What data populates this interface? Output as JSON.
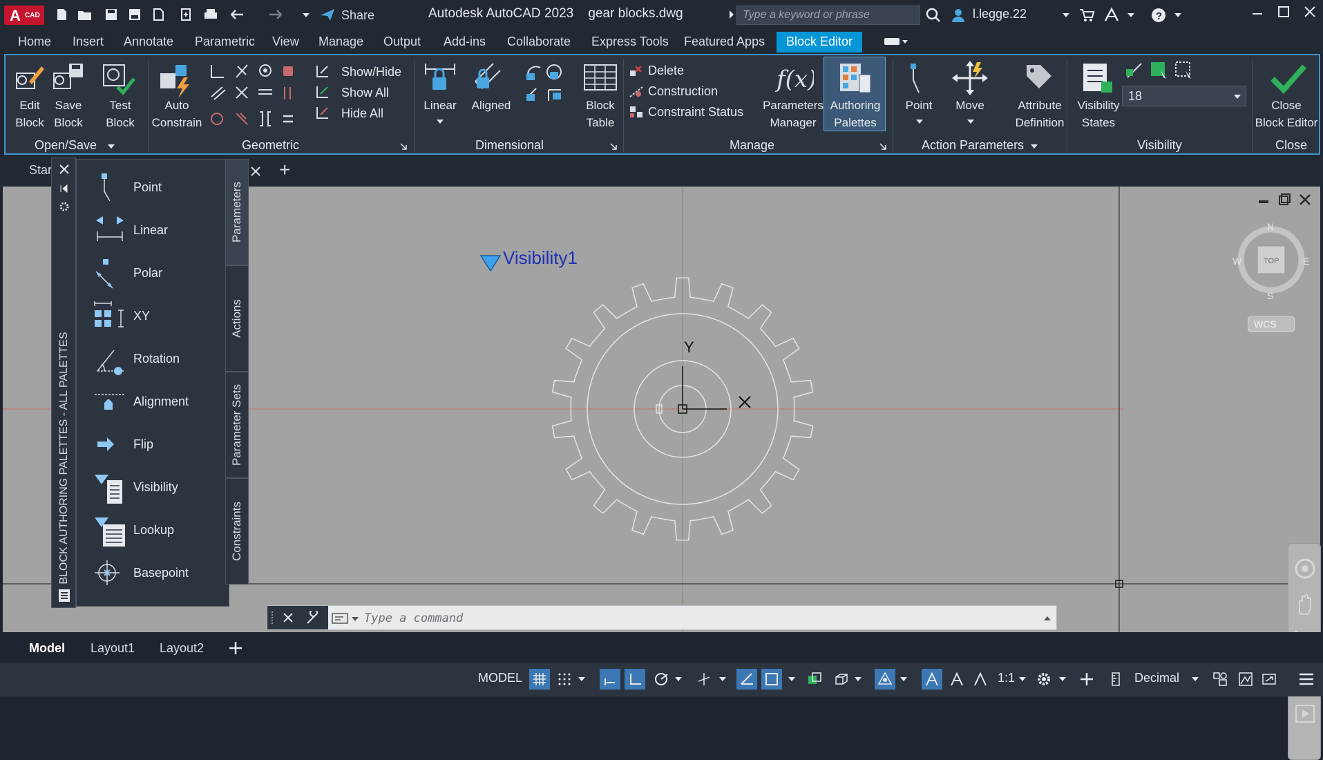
{
  "titlebar": {
    "app_badge_letter": "A",
    "app_badge_text": "CAD",
    "share_label": "Share",
    "app_title": "Autodesk AutoCAD 2023",
    "file_name": "gear blocks.dwg",
    "search_placeholder": "Type a keyword or phrase",
    "user_name": "l.legge.22"
  },
  "ribbon_tabs": [
    "Home",
    "Insert",
    "Annotate",
    "Parametric",
    "View",
    "Manage",
    "Output",
    "Add-ins",
    "Collaborate",
    "Express Tools",
    "Featured Apps",
    "Block Editor"
  ],
  "ribbon": {
    "open_save": {
      "title": "Open/Save",
      "edit_block": [
        "Edit",
        "Block"
      ],
      "save_block": [
        "Save",
        "Block"
      ],
      "test_block": [
        "Test",
        "Block"
      ]
    },
    "geometric": {
      "title": "Geometric",
      "auto_constrain": [
        "Auto",
        "Constrain"
      ],
      "show_hide": "Show/Hide",
      "show_all": "Show All",
      "hide_all": "Hide All"
    },
    "dimensional": {
      "title": "Dimensional",
      "linear": "Linear",
      "aligned": "Aligned",
      "block_table": [
        "Block",
        "Table"
      ]
    },
    "manage": {
      "title": "Manage",
      "delete": "Delete",
      "construction": "Construction",
      "constraint_status": "Constraint Status",
      "parameters_manager": [
        "Parameters",
        "Manager"
      ],
      "authoring_palettes": [
        "Authoring",
        "Palettes"
      ]
    },
    "action_parameters": {
      "title": "Action Parameters",
      "point": "Point",
      "move": "Move",
      "attribute_definition": [
        "Attribute",
        "Definition"
      ]
    },
    "visibility": {
      "title": "Visibility",
      "visibility_states": [
        "Visibility",
        "States"
      ],
      "selected_state": "18"
    },
    "close": {
      "title": "Close",
      "close_block_editor": [
        "Close",
        "Block Editor"
      ]
    }
  },
  "filetabs": {
    "start": "Star",
    "add": "+"
  },
  "palette": {
    "strip_title": "BLOCK AUTHORING PALETTES - ALL PALETTES",
    "items": [
      "Point",
      "Linear",
      "Polar",
      "XY",
      "Rotation",
      "Alignment",
      "Flip",
      "Visibility",
      "Lookup",
      "Basepoint"
    ],
    "tabs": [
      "Parameters",
      "Actions",
      "Parameter Sets",
      "Constraints"
    ]
  },
  "drawing": {
    "visibility_parameter_label": "Visibility1",
    "ucs_y": "Y",
    "ucs_x": "X",
    "viewcube": {
      "north": "N",
      "south": "S",
      "east": "E",
      "west": "W",
      "face": "TOP",
      "wcs": "WCS"
    }
  },
  "command_line": {
    "placeholder": "Type a command"
  },
  "layout_tabs": [
    "Model",
    "Layout1",
    "Layout2"
  ],
  "statusbar": {
    "model_label": "MODEL",
    "scale": "1:1",
    "units": "Decimal"
  },
  "colors": {
    "accent": "#0696d7",
    "canvas": "#a3a3a3",
    "panel": "#2c3440",
    "gear_line": "#d9d9d9",
    "visibility_text": "#1e2fb4"
  }
}
